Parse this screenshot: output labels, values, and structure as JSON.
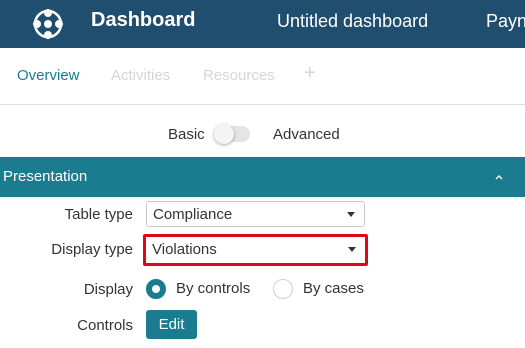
{
  "header": {
    "app_title": "Dashboard",
    "dashboard_name": "Untitled dashboard",
    "truncated_item": "Payn",
    "logo_icon": "hub-network-icon",
    "background_color": "#1f4e6e"
  },
  "tabs": [
    {
      "label": "Overview",
      "state": "active"
    },
    {
      "label": "Activities",
      "state": "disabled"
    },
    {
      "label": "Resources",
      "state": "disabled"
    }
  ],
  "add_tab": {
    "label": "+"
  },
  "mode": {
    "basic_label": "Basic",
    "advanced_label": "Advanced",
    "advanced_enabled": false
  },
  "section": {
    "title": "Presentation",
    "expanded": true,
    "chevron_icon": "chevron-up-icon",
    "background_color": "#1b7c90"
  },
  "form": {
    "table_type": {
      "label": "Table type",
      "value": "Compliance"
    },
    "display_type": {
      "label": "Display type",
      "value": "Violations",
      "highlighted": true,
      "highlight_color": "#e0061a"
    },
    "display": {
      "label": "Display",
      "options": [
        {
          "label": "By controls",
          "checked": true
        },
        {
          "label": "By cases",
          "checked": false
        }
      ]
    },
    "controls": {
      "label": "Controls",
      "button_label": "Edit"
    }
  }
}
